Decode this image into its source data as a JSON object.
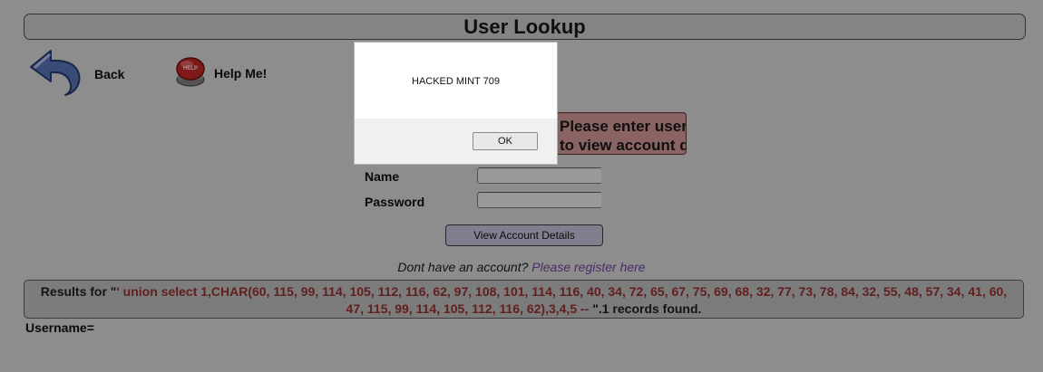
{
  "page": {
    "title": "User Lookup"
  },
  "nav": {
    "back_label": "Back",
    "help_label": "Help Me!",
    "help_icon_text": "HELP"
  },
  "login": {
    "banner_line1": "Please enter username and password",
    "banner_line2": "to view account details",
    "name_label": "Name",
    "password_label": "Password",
    "name_value": "",
    "password_value": "",
    "submit_label": "View Account Details",
    "register_prompt": "Dont have an account?",
    "register_link": "Please register here"
  },
  "results": {
    "prefix": "Results for \"",
    "query": "' union select 1,CHAR(60, 115, 99, 114, 105, 112, 116, 62, 97, 108, 101, 114, 116, 40, 34, 72, 65, 67, 75, 69, 68, 32, 77, 73, 78, 84, 32, 55, 48, 57, 34, 41, 60, 47, 115, 99, 114, 105, 112, 116, 62),3,4,5 --",
    "suffix": " \".1 records found."
  },
  "username_line": "Username=",
  "alert": {
    "message": "HACKED MINT 709",
    "ok_label": "OK"
  },
  "colors": {
    "banner_bg": "#e7a5a5",
    "query_text": "#a33434",
    "submit_bg": "#d4d4ee",
    "link": "#7a4aa8"
  }
}
